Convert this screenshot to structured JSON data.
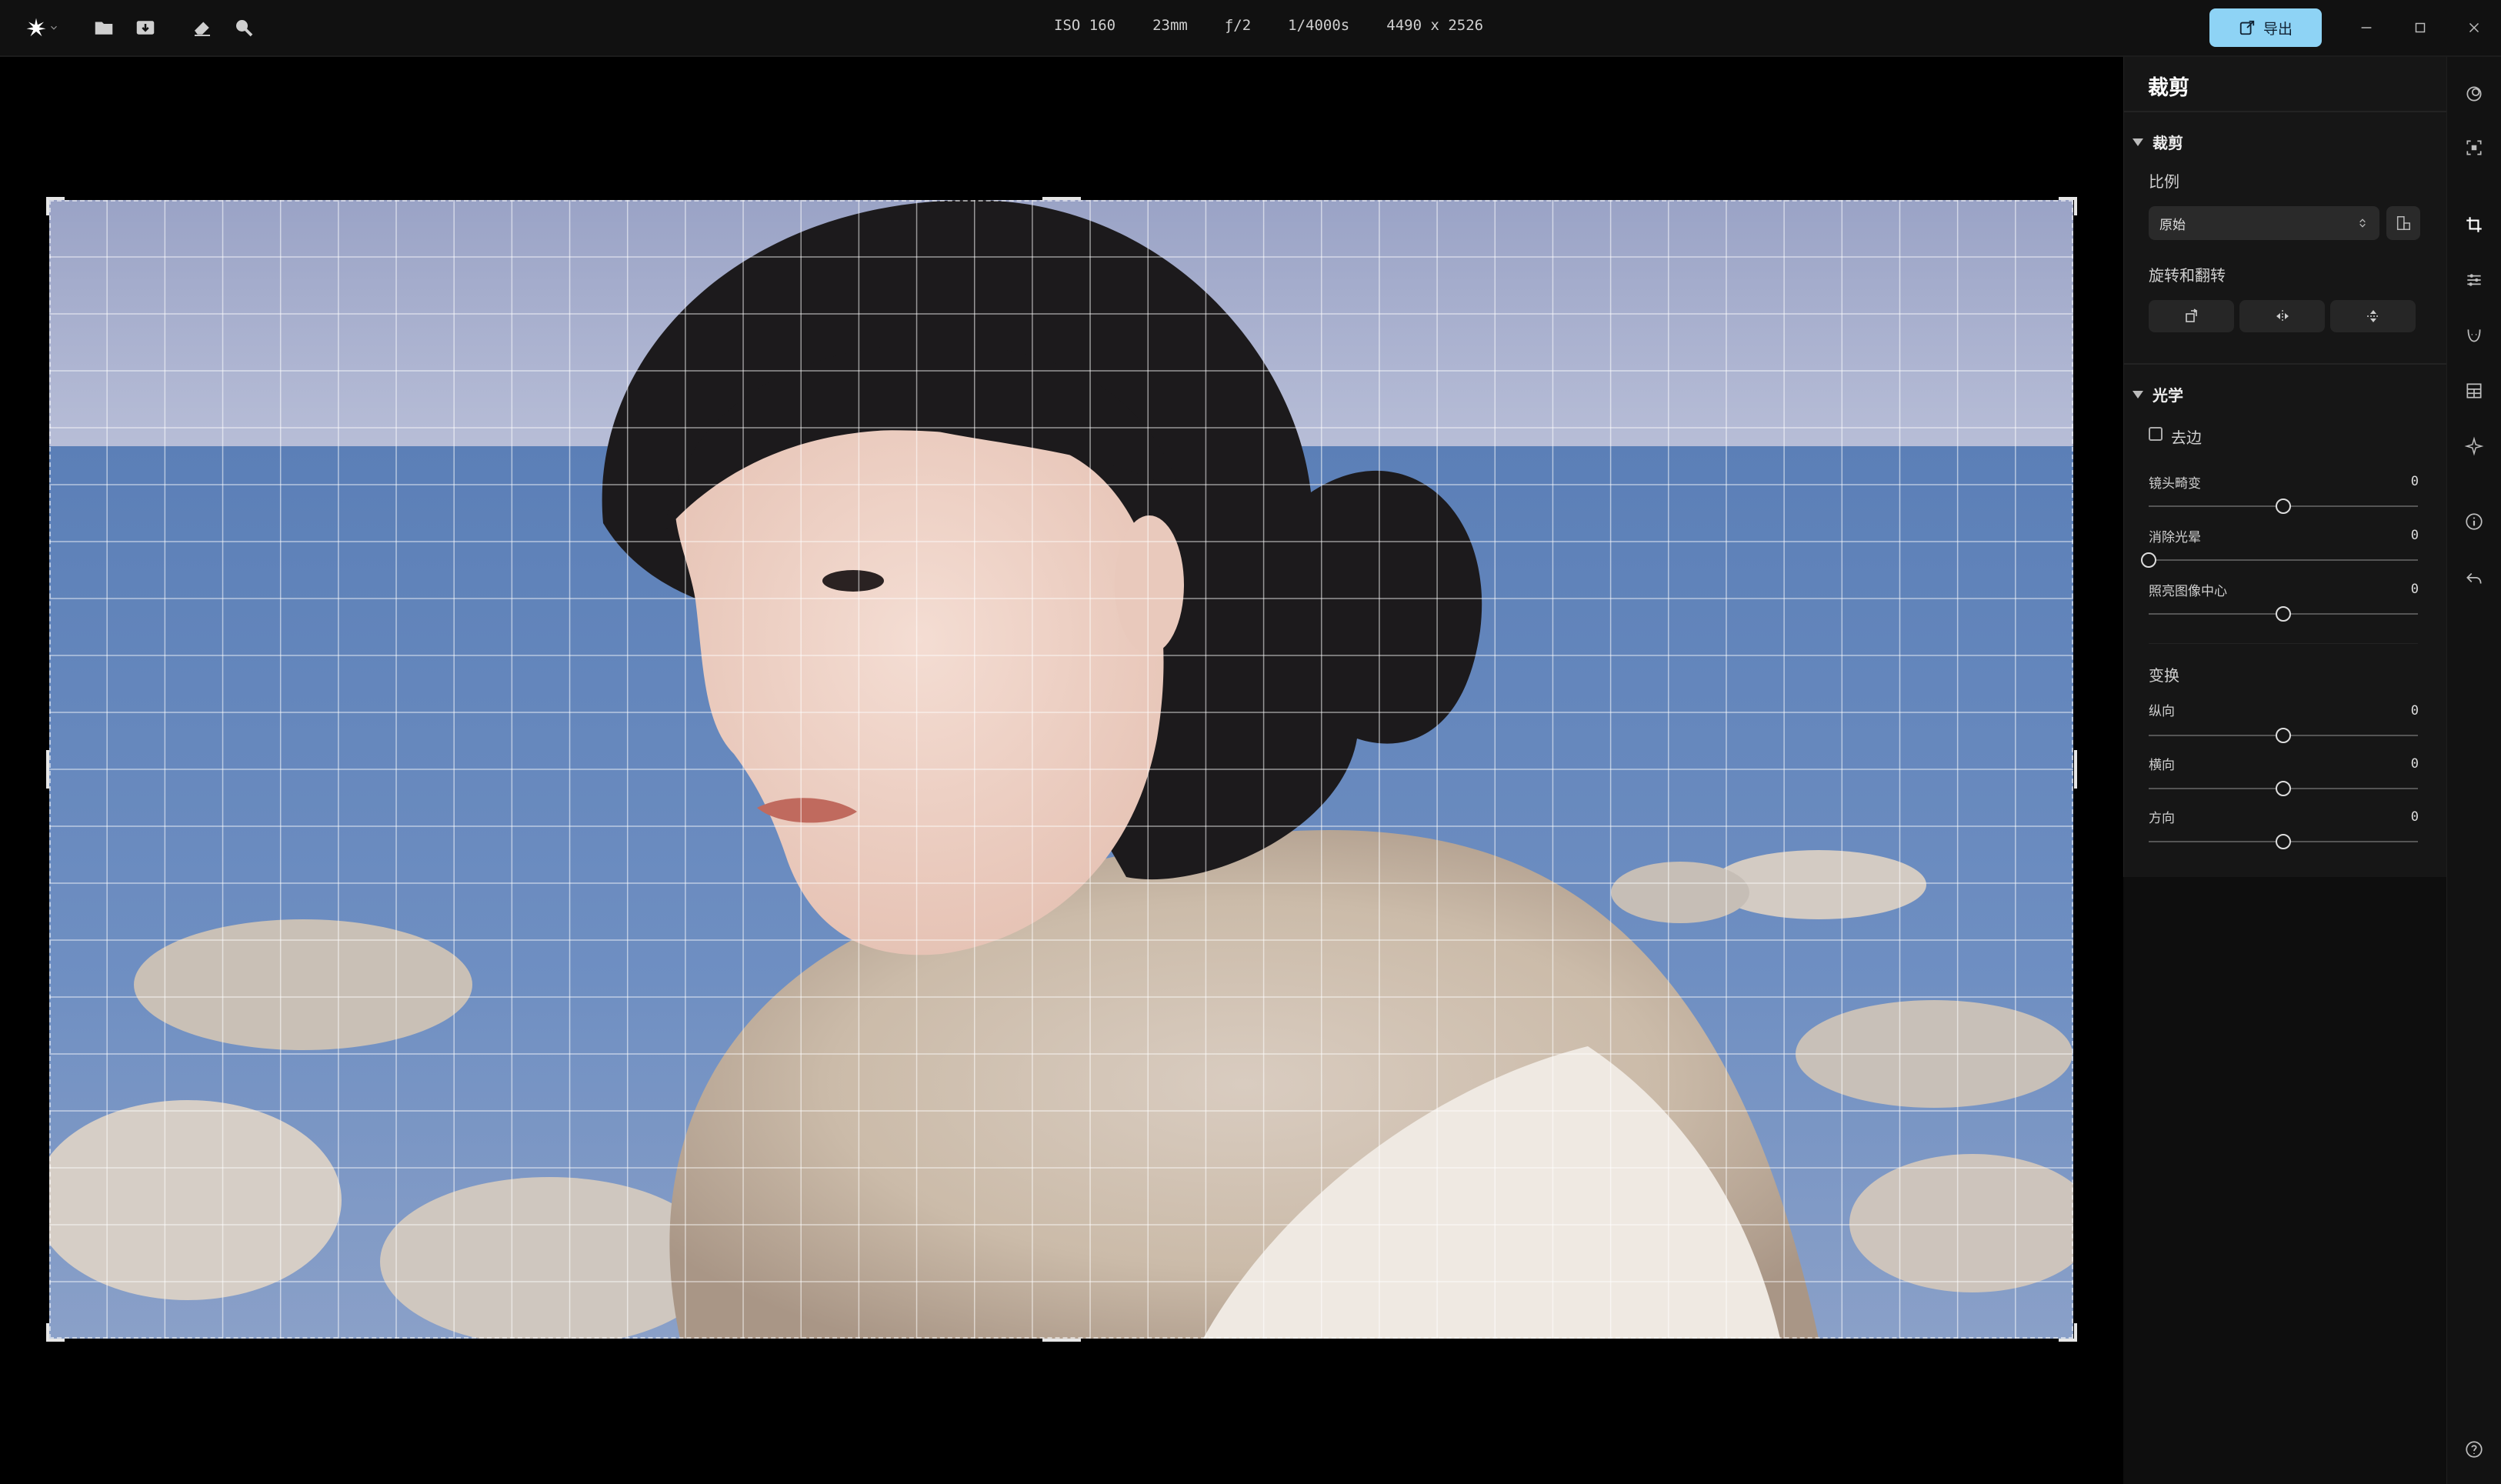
{
  "topbar": {
    "icons": [
      "logo-star-icon",
      "folder-icon",
      "import-image-icon",
      "eraser-icon",
      "zoom-icon"
    ],
    "meta": {
      "iso": "ISO 160",
      "focal": "23mm",
      "aperture": "ƒ/2",
      "shutter": "1/4000s",
      "dimensions": "4490 x 2526"
    },
    "export_label": "导出",
    "window_controls": [
      "minimize-icon",
      "maximize-icon",
      "close-icon"
    ]
  },
  "canvas": {
    "grid_columns": 35,
    "grid_rows": 20
  },
  "panel": {
    "title": "裁剪",
    "crop": {
      "header": "裁剪",
      "ratio_label": "比例",
      "ratio_value": "原始",
      "rotate_flip_label": "旋转和翻转"
    },
    "optics": {
      "header": "光学",
      "dewarp_label": "去边",
      "dewarp_checked": false,
      "sliders": [
        {
          "label": "镜头畸变",
          "value": "0",
          "position": 0.5
        },
        {
          "label": "消除光晕",
          "value": "0",
          "position": 0.0
        },
        {
          "label": "照亮图像中心",
          "value": "0",
          "position": 0.5
        }
      ]
    },
    "transform": {
      "header": "变换",
      "sliders": [
        {
          "label": "纵向",
          "value": "0",
          "position": 0.5
        },
        {
          "label": "横向",
          "value": "0",
          "position": 0.5
        },
        {
          "label": "方向",
          "value": "0",
          "position": 0.5
        }
      ]
    }
  },
  "rail": {
    "icons": [
      "masks-icon",
      "select-icon",
      "crop-icon",
      "adjust-icon",
      "face-icon",
      "grid-icon",
      "magic-icon",
      "info-icon",
      "undo-icon",
      "help-icon"
    ],
    "active": "crop-icon"
  },
  "colors": {
    "accent": "#8ed3f5",
    "panel_bg": "#161616",
    "canvas_bg": "#000000"
  }
}
